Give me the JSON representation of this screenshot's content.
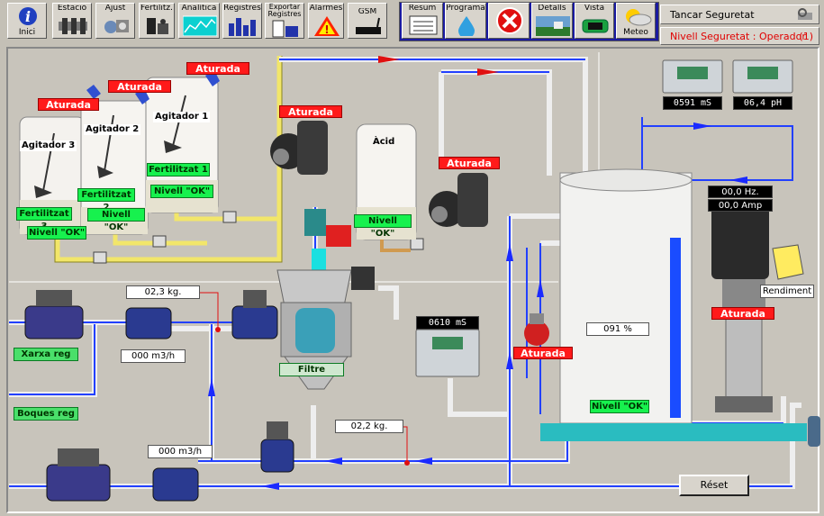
{
  "toolbar": {
    "inici": "Inici",
    "estacio": "Estació",
    "ajust": "Ajust",
    "fertilitz": "Fertilitz.",
    "analitica": "Analítica",
    "registres": "Registres",
    "exportar_1": "Exportar",
    "exportar_2": "Registres",
    "alarmes": "Alarmes",
    "gsm": "GSM",
    "resum": "Resum",
    "programa": "Programa",
    "detalls": "Detalls",
    "vista": "Vista",
    "meteo": "Meteo"
  },
  "header": {
    "tancar": "Tancar Seguretat",
    "nivell": "Nivell Seguretat : Operador",
    "nivell_num": "(1)"
  },
  "tanks": {
    "agitador1": "Agitador 1",
    "agitador2": "Agitador 2",
    "agitador3": "Agitador 3",
    "fert1": "Fertilitzat 1",
    "fert2": "Fertilitzat 2",
    "fert3": "Fertilitzat 3",
    "acid": "Àcid"
  },
  "status": {
    "aturada": "Aturada",
    "nivell_ok": "Nivell \"OK\""
  },
  "readings": {
    "conductivity_top": "0591 mS",
    "ph": "06,4 pH",
    "freq": "00,0 Hz.",
    "amp": "00,0 Amp",
    "conductivity_mid": "0610 mS",
    "level_pct": "091 %",
    "kg_top": "02,3 kg.",
    "kg_bottom": "02,2 kg.",
    "flow_top": "000 m3/h",
    "flow_bottom": "000 m3/h"
  },
  "labels": {
    "xarxa": "Xarxa reg",
    "boques": "Boques reg",
    "filtre": "Filtre",
    "rendiment": "Rendiment",
    "reset": "Réset"
  },
  "colors": {
    "alarm_red": "#ff1a1a",
    "ok_green": "#17f14e",
    "pipe_blue": "#1a3cff",
    "pipe_yellow": "#f2e66a",
    "panel_bg": "#c8c4bb"
  }
}
